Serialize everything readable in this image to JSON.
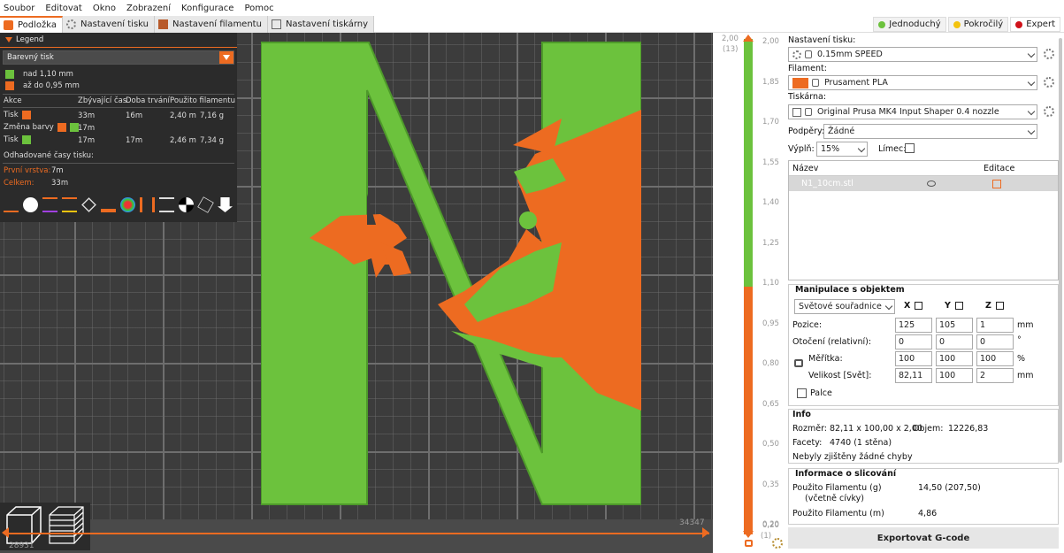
{
  "menu": [
    "Soubor",
    "Editovat",
    "Okno",
    "Zobrazení",
    "Konfigurace",
    "Pomoc"
  ],
  "tabs": [
    {
      "label": "Podložka"
    },
    {
      "label": "Nastavení tisku"
    },
    {
      "label": "Nastavení filamentu"
    },
    {
      "label": "Nastavení tiskárny"
    }
  ],
  "modes": [
    {
      "label": "Jednoduchý",
      "color": "#6cc23d"
    },
    {
      "label": "Pokročilý",
      "color": "#f3c30f"
    },
    {
      "label": "Expert",
      "color": "#d0121a"
    }
  ],
  "legend": {
    "title": "Legend",
    "view_type": "Barevný tisk",
    "items": [
      "nad 1,10 mm",
      "až do 0,95 mm"
    ],
    "headers": [
      "Akce",
      "Zbývající čas",
      "Doba trvání",
      "Použito filamentu"
    ],
    "rows": [
      {
        "action": "Tisk",
        "remaining": "33m",
        "duration": "16m",
        "used_m": "2,40 m",
        "used_g": "7,16 g"
      },
      {
        "action": "Změna barvy",
        "remaining": "17m",
        "duration": "",
        "used_m": "",
        "used_g": ""
      },
      {
        "action": "Tisk",
        "remaining": "17m",
        "duration": "17m",
        "used_m": "2,46 m",
        "used_g": "7,34 g"
      }
    ],
    "estimated_label": "Odhadované časy tisku:",
    "first_layer_label": "První vrstva:",
    "first_layer": "7m",
    "total_label": "Celkem:",
    "total": "33m"
  },
  "view": {
    "hslider_left": "28931",
    "hslider_right": "34347",
    "vslider_top_value": "2,00",
    "vslider_top_layer": "(13)",
    "vslider_bottom_value": "0,20",
    "vslider_bottom_layer": "(1)",
    "vticks": [
      "2,00",
      "1,85",
      "1,70",
      "1,55",
      "1,40",
      "1,25",
      "1,10",
      "0,95",
      "0,80",
      "0,65",
      "0,50",
      "0,35",
      "0,20"
    ]
  },
  "sidebar": {
    "print_settings_label": "Nastavení tisku:",
    "print_settings": "0.15mm SPEED",
    "filament_label": "Filament:",
    "filament": "Prusament PLA",
    "filament_color": "#ed6b21",
    "printer_label": "Tiskárna:",
    "printer": "Original Prusa MK4 Input Shaper 0.4 nozzle",
    "supports_label": "Podpěry:",
    "supports": "Žádné",
    "infill_label": "Výplň:",
    "infill": "15%",
    "brim_label": "Límec:",
    "list_name_header": "Název",
    "list_edit_header": "Editace",
    "object_name": "N1_10cm.stl",
    "manip_title": "Manipulace s objektem",
    "coord_system": "Světové souřadnice",
    "x_label": "X",
    "y_label": "Y",
    "z_label": "Z",
    "position_label": "Pozice:",
    "position": [
      "125",
      "105",
      "1"
    ],
    "unit_mm": "mm",
    "rotation_label": "Otočení (relativní):",
    "rotation": [
      "0",
      "0",
      "0"
    ],
    "unit_deg": "°",
    "scale_label": "Měřítka:",
    "scale": [
      "100",
      "100",
      "100"
    ],
    "unit_pct": "%",
    "size_label": "Velikost [Svět]:",
    "size": [
      "82,11",
      "100",
      "2"
    ],
    "inches_label": "Palce",
    "info_title": "Info",
    "size_info_label": "Rozměr:",
    "size_info": "82,11 x 100,00 x 2,00",
    "volume_label": "Objem:",
    "volume": "12226,83",
    "facets_label": "Facety:",
    "facets": "4740 (1 stěna)",
    "errors": "Nebyly zjištěny žádné chyby",
    "slice_title": "Informace o slicování",
    "used_g_label": "Použito Filamentu (g)",
    "used_g_sub": "(včetně cívky)",
    "used_g": "14,50 (207,50)",
    "used_m_label": "Použito Filamentu (m)",
    "used_m": "4,86",
    "export": "Exportovat G-code"
  }
}
